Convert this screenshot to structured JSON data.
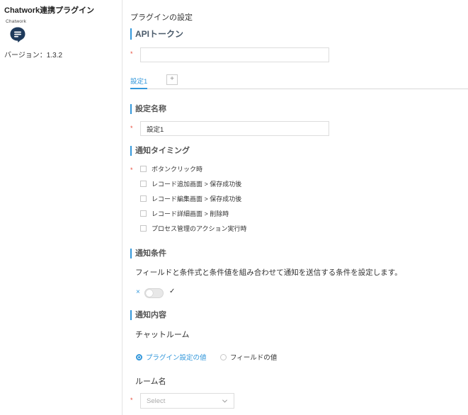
{
  "sidebar": {
    "plugin_title": "Chatwork連携プラグイン",
    "logo_text": "Chatwork",
    "logo_icon": "chat-bubble-icon",
    "version": "バージョン：1.3.2"
  },
  "page": {
    "title": "プラグインの設定"
  },
  "api_token": {
    "heading": "APIトークン",
    "required_mark": "*",
    "value": ""
  },
  "tabs": {
    "items": [
      {
        "label": "設定1",
        "active": true
      }
    ],
    "add_label": "+"
  },
  "setting_name": {
    "heading": "設定名称",
    "required_mark": "*",
    "value": "設定1"
  },
  "timing": {
    "heading": "通知タイミング",
    "required_mark": "*",
    "options": [
      {
        "label": "ボタンクリック時",
        "checked": false
      },
      {
        "label": "レコード追加画面 > 保存成功後",
        "checked": false
      },
      {
        "label": "レコード編集画面 > 保存成功後",
        "checked": false
      },
      {
        "label": "レコード詳細画面 > 削除時",
        "checked": false
      },
      {
        "label": "プロセス管理のアクション実行時",
        "checked": false
      }
    ]
  },
  "conditions": {
    "heading": "通知条件",
    "description": "フィールドと条件式と条件値を組み合わせて通知を送信する条件を設定します。",
    "toggle_off_symbol": "×",
    "toggle_on_symbol": "✓",
    "enabled": false
  },
  "content": {
    "heading": "通知内容",
    "chat_room_label": "チャットルーム",
    "radio_options": [
      {
        "label": "プラグイン設定の値",
        "selected": true
      },
      {
        "label": "フィールドの値",
        "selected": false
      }
    ],
    "room_name_label": "ルーム名",
    "required_mark": "*",
    "select_placeholder": "Select"
  },
  "colors": {
    "accent": "#3498db",
    "required": "#e74c3c",
    "border": "#dddddd"
  }
}
